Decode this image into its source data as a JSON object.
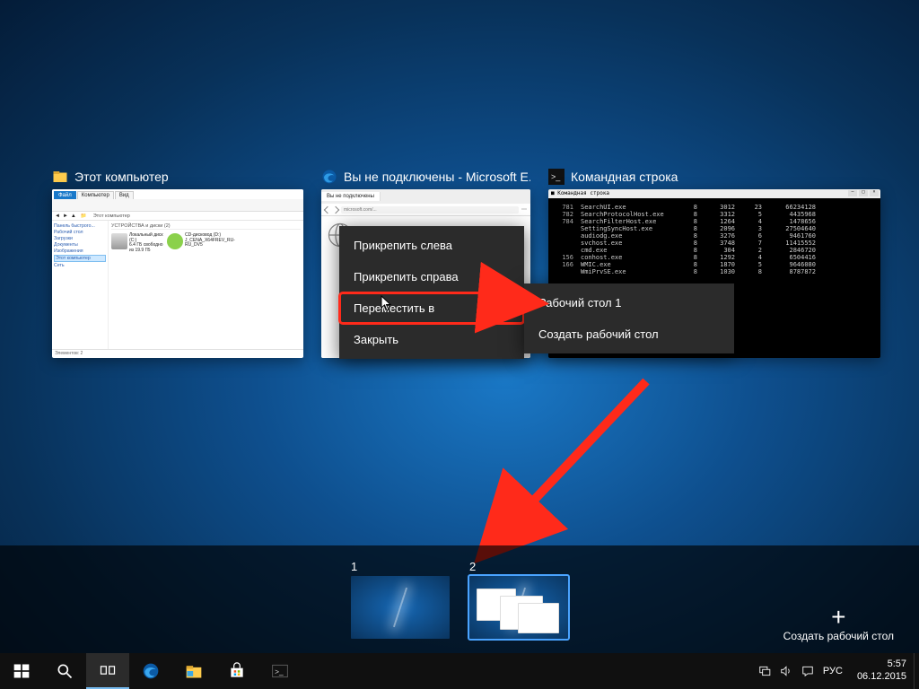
{
  "windows": {
    "explorer": {
      "title": "Этот компьютер",
      "tabs": [
        "Файл",
        "Компьютер",
        "Вид"
      ],
      "breadcrumb": "Этот компьютер",
      "nav": [
        "Панель быстрого...",
        "Рабочий стол",
        "Загрузки",
        "Документы",
        "Изображения",
        "Этот компьютер",
        "Сеть"
      ],
      "section": "УСТРОЙСТВА и диски (2)",
      "items": [
        {
          "name": "Локальный диск (C:)",
          "sub": "6.4 ГБ свободно из 19.9 ГБ"
        },
        {
          "name": "CD-дисковод (D:) J_CENA_X64FREV_RU-RU_DV5"
        }
      ],
      "status": "Элементов: 2"
    },
    "edge": {
      "title": "Вы не подключены - Microsoft E...",
      "tab": "Вы не подключены",
      "url": "microsoft.com/..."
    },
    "cmd": {
      "title": "Командная строка",
      "wintitle": "Командная строка",
      "rows": [
        [
          "781",
          "SearchUI.exe",
          "8",
          "3012",
          "23",
          "66234128"
        ],
        [
          "782",
          "SearchProtocolHost.exe",
          "8",
          "3312",
          "5",
          "4435968"
        ],
        [
          "784",
          "SearchFilterHost.exe",
          "8",
          "1264",
          "4",
          "1478656"
        ],
        [
          "",
          "SettingSyncHost.exe",
          "8",
          "2096",
          "3",
          "27504640"
        ],
        [
          "",
          "audiodg.exe",
          "8",
          "3276",
          "6",
          "9461760"
        ],
        [
          "",
          "svchost.exe",
          "8",
          "3748",
          "7",
          "11415552"
        ],
        [
          "",
          "cmd.exe",
          "8",
          "304",
          "2",
          "2846720"
        ],
        [
          "156",
          "conhost.exe",
          "8",
          "1292",
          "4",
          "6504416"
        ],
        [
          "166",
          "WMIC.exe",
          "8",
          "1870",
          "5",
          "9646080"
        ],
        [
          "",
          "WmiPrvSE.exe",
          "8",
          "1030",
          "8",
          "8787872"
        ]
      ]
    }
  },
  "context_menu": {
    "pin_left": "Прикрепить слева",
    "pin_right": "Прикрепить справа",
    "move_to": "Переместить в",
    "close": "Закрыть",
    "sub": {
      "desktop1": "Рабочий стол 1",
      "create": "Создать рабочий стол"
    }
  },
  "desktops": {
    "d1_label": "1",
    "d2_label": "2"
  },
  "new_desktop_label": "Создать рабочий стол",
  "systray": {
    "lang": "РУС"
  },
  "clock": {
    "time": "5:57",
    "date": "06.12.2015"
  }
}
